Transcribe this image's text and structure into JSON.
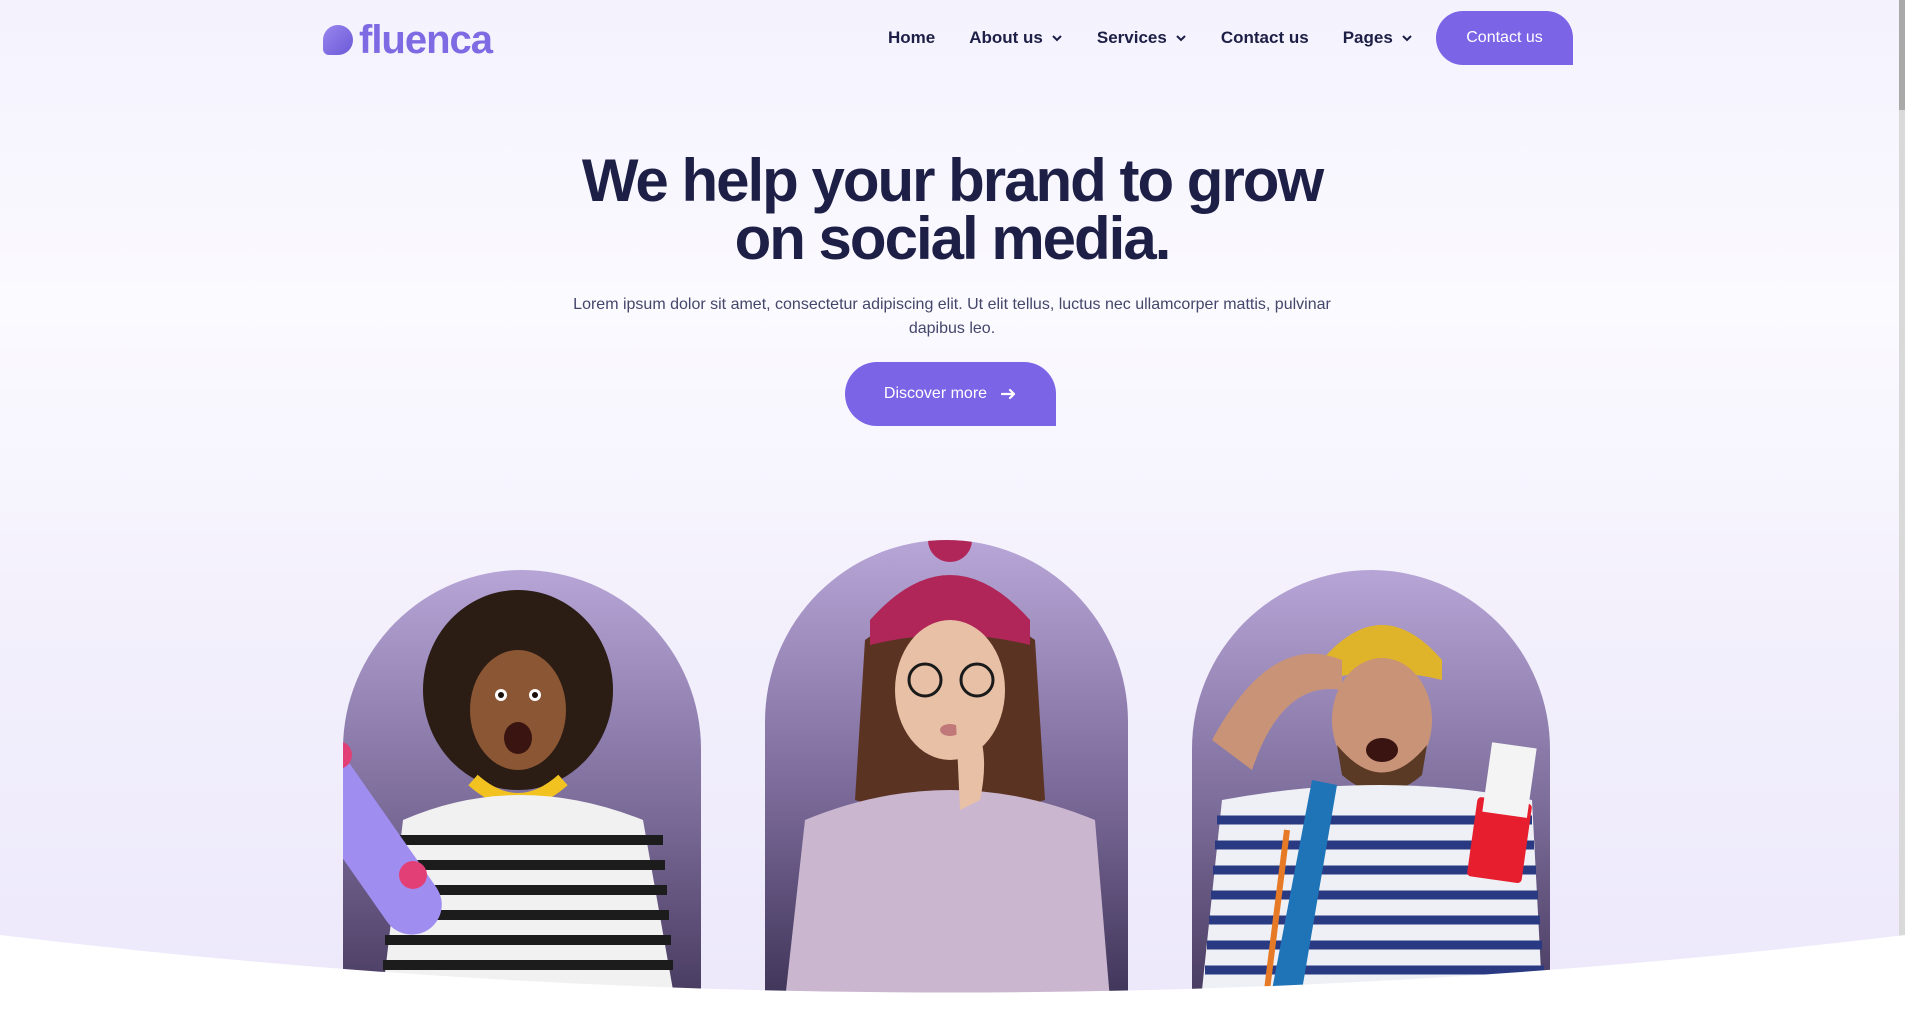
{
  "brand": {
    "name": "fluenca",
    "color": "#7b64e6"
  },
  "nav": {
    "items": [
      {
        "label": "Home",
        "dropdown": false
      },
      {
        "label": "About us",
        "dropdown": true
      },
      {
        "label": "Services",
        "dropdown": true
      },
      {
        "label": "Contact us",
        "dropdown": false
      },
      {
        "label": "Pages",
        "dropdown": true
      }
    ],
    "cta_label": "Contact us"
  },
  "hero": {
    "title_line1": "We help your brand to grow",
    "title_line2": "on social media.",
    "text": "Lorem ipsum dolor sit amet, consectetur adipiscing elit. Ut elit tellus, luctus nec ullamcorper mattis, pulvinar dapibus leo.",
    "button_label": "Discover more",
    "button_icon": "arrow-right-icon"
  },
  "images": [
    {
      "name": "surprised-woman-skateboard"
    },
    {
      "name": "pensive-woman-beanie"
    },
    {
      "name": "excited-man-passport"
    }
  ]
}
